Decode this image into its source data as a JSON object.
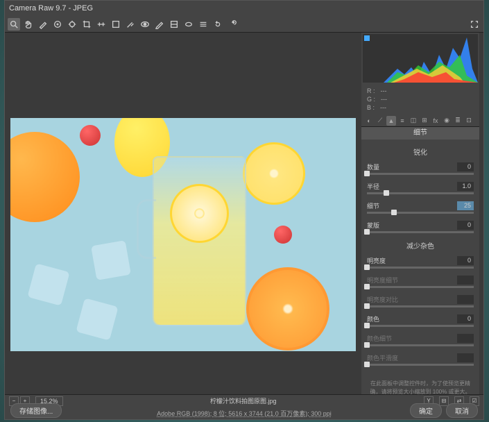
{
  "titlebar": {
    "text": "Camera Raw 9.7  -  JPEG"
  },
  "rgb": {
    "r_label": "R :",
    "r_val": "---",
    "g_label": "G :",
    "g_val": "---",
    "b_label": "B :",
    "b_val": "---"
  },
  "panel": {
    "tab_title": "细节",
    "section_sharpen": "锐化",
    "section_noise": "减少杂色",
    "sliders": {
      "amount": {
        "label": "数量",
        "value": "0",
        "pos": 0
      },
      "radius": {
        "label": "半径",
        "value": "1.0",
        "pos": 18
      },
      "detail": {
        "label": "细节",
        "value": "25",
        "pos": 25,
        "active": true
      },
      "mask": {
        "label": "蒙版",
        "value": "0",
        "pos": 0
      },
      "lum": {
        "label": "明亮度",
        "value": "0",
        "pos": 0
      },
      "lumd": {
        "label": "明亮度细节",
        "value": "",
        "pos": 0,
        "disabled": true
      },
      "lumc": {
        "label": "明亮度对比",
        "value": "",
        "pos": 0,
        "disabled": true
      },
      "col": {
        "label": "颜色",
        "value": "0",
        "pos": 0
      },
      "cold": {
        "label": "颜色细节",
        "value": "",
        "pos": 0,
        "disabled": true
      },
      "cols": {
        "label": "颜色平滑度",
        "value": "",
        "pos": 0,
        "disabled": true
      }
    },
    "hint": "在此面板中调整控件时，为了使预览更精确，请将预览大小缩放到 100% 或更大。"
  },
  "footer": {
    "zoom": "15.2%",
    "filename": "柠檬汁饮料拍图原图.jpg",
    "meta": "Adobe RGB (1998); 8 位; 5616 x 3744 (21.0 百万像素); 300 ppi"
  },
  "buttons": {
    "save": "存储图像...",
    "ok": "确定",
    "cancel": "取消"
  }
}
